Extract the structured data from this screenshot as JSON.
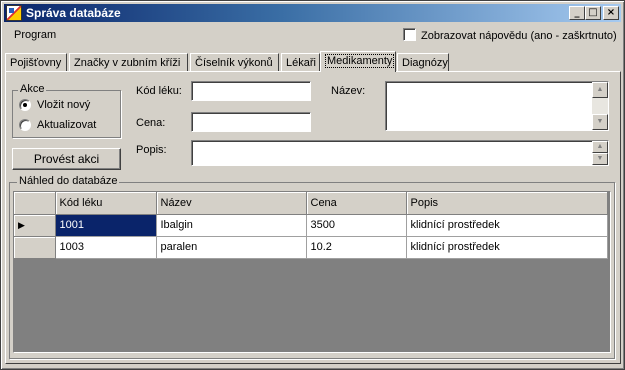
{
  "window": {
    "title": "Správa databáze",
    "buttons": {
      "minimize": "_",
      "maximize": "□",
      "close": "×"
    }
  },
  "menu": {
    "program": "Program"
  },
  "help_toggle": {
    "label": "Zobrazovat nápovědu (ano - zaškrtnuto)",
    "checked": false
  },
  "tabs": [
    {
      "label": "Pojišťovny",
      "active": false
    },
    {
      "label": "Značky v zubním kříži",
      "active": false
    },
    {
      "label": "Číselník výkonů",
      "active": false
    },
    {
      "label": "Lékaři",
      "active": false
    },
    {
      "label": "Medikamenty",
      "active": true
    },
    {
      "label": "Diagnózy",
      "active": false
    }
  ],
  "action_group": {
    "title": "Akce",
    "options": [
      {
        "label": "Vložit nový",
        "selected": true
      },
      {
        "label": "Aktualizovat",
        "selected": false
      }
    ]
  },
  "form": {
    "code_label": "Kód léku:",
    "code_value": "",
    "price_label": "Cena:",
    "price_value": "",
    "name_label": "Název:",
    "name_value": "",
    "description_label": "Popis:",
    "description_value": "",
    "execute_button": "Provést akci"
  },
  "preview": {
    "title": "Náhled do databáze",
    "columns": [
      "Kód léku",
      "Název",
      "Cena",
      "Popis"
    ],
    "rows": [
      [
        "1001",
        "Ibalgin",
        "3500",
        "klidnící prostředek"
      ],
      [
        "1003",
        "paralen",
        "10.2",
        "klidnící prostředek"
      ]
    ],
    "current_row_marker": "▶"
  },
  "colors": {
    "titlebar_start": "#0a246a",
    "titlebar_end": "#a6caf0",
    "face": "#d4d0c8",
    "selection": "#0a246a",
    "grid_background": "#808080"
  }
}
